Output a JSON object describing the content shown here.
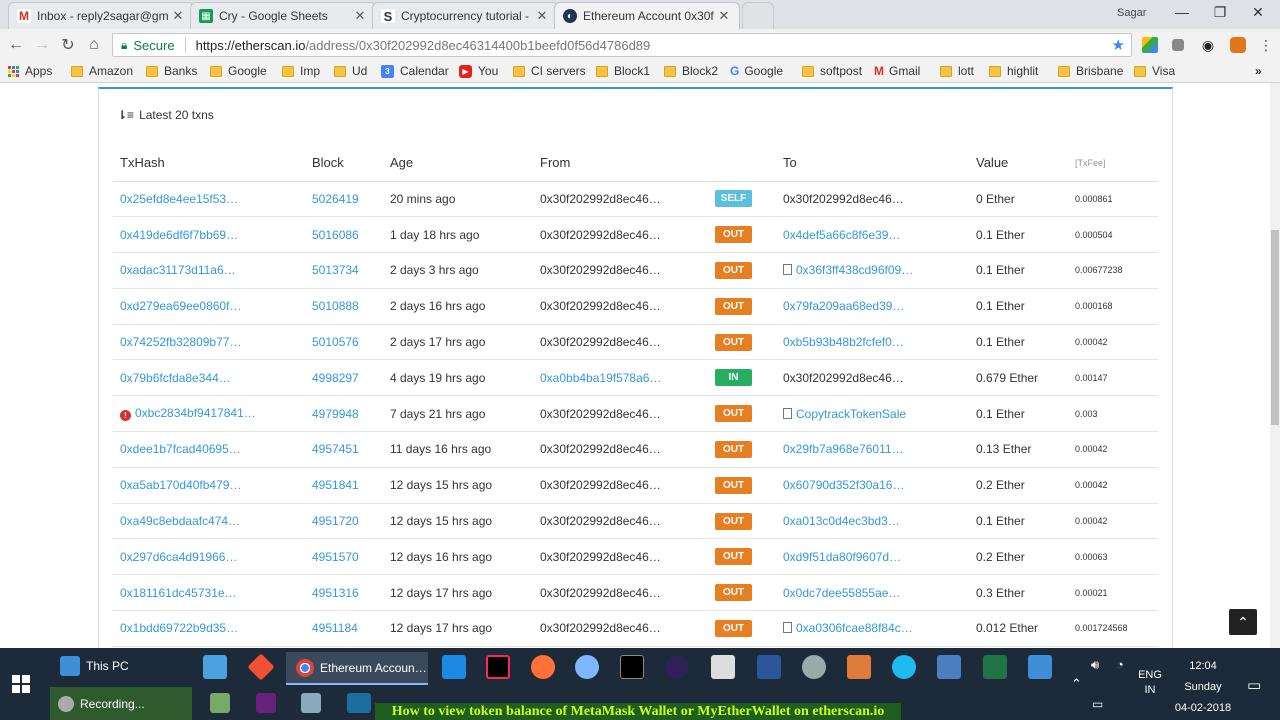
{
  "browser": {
    "user": "Sagar",
    "tabs": [
      {
        "title": "Inbox - reply2sagar@gm",
        "icon": "gmail-icon",
        "color": "#d93025"
      },
      {
        "title": "Cry - Google Sheets",
        "icon": "sheets-icon",
        "color": "#0f9d58"
      },
      {
        "title": "Cryptocurrency tutorial -",
        "icon": "s-icon",
        "color": "#333333"
      },
      {
        "title": "Ethereum Account 0x30f",
        "icon": "etherscan-icon",
        "color": "#21325b"
      }
    ],
    "secure_label": "Secure",
    "url_host": "https://etherscan.io",
    "url_path": "/address/0x30f202992d8ec46314400b1beefd0f56d4786d89",
    "bookmarks": [
      {
        "label": "Apps",
        "icon": "apps-icon"
      },
      {
        "label": "Amazon",
        "icon": "folder-icon"
      },
      {
        "label": "Banks",
        "icon": "folder-icon"
      },
      {
        "label": "Google",
        "icon": "folder-icon"
      },
      {
        "label": "Imp",
        "icon": "folder-icon"
      },
      {
        "label": "Ud",
        "icon": "folder-icon"
      },
      {
        "label": "Calendar",
        "icon": "calendar-icon"
      },
      {
        "label": "You",
        "icon": "youtube-icon"
      },
      {
        "label": "CI servers",
        "icon": "folder-icon"
      },
      {
        "label": "Block1",
        "icon": "folder-icon"
      },
      {
        "label": "Block2",
        "icon": "folder-icon"
      },
      {
        "label": "Google",
        "icon": "google-icon"
      },
      {
        "label": "softpost",
        "icon": "folder-icon"
      },
      {
        "label": "Gmail",
        "icon": "gmail-icon"
      },
      {
        "label": "lott",
        "icon": "folder-icon"
      },
      {
        "label": "highlit",
        "icon": "folder-icon"
      },
      {
        "label": "Brisbane",
        "icon": "folder-icon"
      },
      {
        "label": "Visa",
        "icon": "folder-icon"
      }
    ]
  },
  "txlist": {
    "latest_label": "Latest 20 txns",
    "headers": {
      "hash": "TxHash",
      "block": "Block",
      "age": "Age",
      "from": "From",
      "to": "To",
      "value": "Value",
      "fee": "[TxFee]"
    },
    "rows": [
      {
        "hash": "0x25efd8e4ee15f53…",
        "block": "5026419",
        "age": "20 mins ago",
        "from": "0x30f202992d8ec46…",
        "from_link": false,
        "dir": "SELF",
        "to": "0x30f202992d8ec46…",
        "to_link": false,
        "to_contract": false,
        "value": "0 Ether",
        "fee": "0.000861",
        "error": false
      },
      {
        "hash": "0x419de6df6f7bb69…",
        "block": "5016086",
        "age": "1 day 18 hrs ago",
        "from": "0x30f202992d8ec46…",
        "from_link": false,
        "dir": "OUT",
        "to": "0x4def5a66c8f6e39…",
        "to_link": true,
        "to_contract": false,
        "value": "0.1 Ether",
        "fee": "0.000504",
        "error": false
      },
      {
        "hash": "0xadac31173d11a6…",
        "block": "5013734",
        "age": "2 days 3 hrs ago",
        "from": "0x30f202992d8ec46…",
        "from_link": false,
        "dir": "OUT",
        "to": "0x36f3ff438cd96f09…",
        "to_link": true,
        "to_contract": true,
        "value": "0.1 Ether",
        "fee": "0.00677238",
        "error": false
      },
      {
        "hash": "0xd279ea69ee0860f…",
        "block": "5010888",
        "age": "2 days 16 hrs ago",
        "from": "0x30f202992d8ec46…",
        "from_link": false,
        "dir": "OUT",
        "to": "0x79fa209aa68ed39…",
        "to_link": true,
        "to_contract": false,
        "value": "0.1 Ether",
        "fee": "0.000168",
        "error": false
      },
      {
        "hash": "0x74252fb32809b77…",
        "block": "5010576",
        "age": "2 days 17 hrs ago",
        "from": "0x30f202992d8ec46…",
        "from_link": false,
        "dir": "OUT",
        "to": "0xb5b93b48b2fcfef0…",
        "to_link": true,
        "to_contract": false,
        "value": "0.1 Ether",
        "fee": "0.00042",
        "error": false
      },
      {
        "hash": "0x79b6fcfda8e344…",
        "block": "4998297",
        "age": "4 days 19 hrs ago",
        "from": "0xa0bb4ba19f578a6…",
        "from_link": true,
        "dir": "IN",
        "to": "0x30f202992d8ec46…",
        "to_link": false,
        "to_contract": false,
        "value": "0.679 Ether",
        "fee": "0.00147",
        "error": false
      },
      {
        "hash": "0xbc2834bf9417841…",
        "block": "4979948",
        "age": "7 days 21 hrs ago",
        "from": "0x30f202992d8ec46…",
        "from_link": false,
        "dir": "OUT",
        "to": "CopytrackTokenSale",
        "to_link": true,
        "to_contract": true,
        "value": "0.1 Ether",
        "fee": "0.003",
        "error": true
      },
      {
        "hash": "0xdee1b7fcad40695…",
        "block": "4957451",
        "age": "11 days 16 hrs ago",
        "from": "0x30f202992d8ec46…",
        "from_link": false,
        "dir": "OUT",
        "to": "0x29fb7a968e76011…",
        "to_link": true,
        "to_contract": false,
        "value": "0.13 Ether",
        "fee": "0.00042",
        "error": false
      },
      {
        "hash": "0xa5ab170d40fb479…",
        "block": "4951841",
        "age": "12 days 15 hrs ago",
        "from": "0x30f202992d8ec46…",
        "from_link": false,
        "dir": "OUT",
        "to": "0x60790d352f30a16…",
        "to_link": true,
        "to_contract": false,
        "value": "0.2 Ether",
        "fee": "0.00042",
        "error": false
      },
      {
        "hash": "0xa49c8ebdaafc474…",
        "block": "4951720",
        "age": "12 days 15 hrs ago",
        "from": "0x30f202992d8ec46…",
        "from_link": false,
        "dir": "OUT",
        "to": "0xa013c0d4ec3bd3…",
        "to_link": true,
        "to_contract": false,
        "value": "0.1 Ether",
        "fee": "0.00042",
        "error": false
      },
      {
        "hash": "0x297d6ca4d91966…",
        "block": "4951570",
        "age": "12 days 16 hrs ago",
        "from": "0x30f202992d8ec46…",
        "from_link": false,
        "dir": "OUT",
        "to": "0xd9f51da80f9607d…",
        "to_link": true,
        "to_contract": false,
        "value": "0.2 Ether",
        "fee": "0.00063",
        "error": false
      },
      {
        "hash": "0x181161dc45731e…",
        "block": "4951316",
        "age": "12 days 17 hrs ago",
        "from": "0x30f202992d8ec46…",
        "from_link": false,
        "dir": "OUT",
        "to": "0x0dc7dee55855ae…",
        "to_link": true,
        "to_contract": false,
        "value": "0.3 Ether",
        "fee": "0.00021",
        "error": false
      },
      {
        "hash": "0x1bdd69722b9d35…",
        "block": "4951184",
        "age": "12 days 17 hrs ago",
        "from": "0x30f202992d8ec46…",
        "from_link": false,
        "dir": "OUT",
        "to": "0xa0306fcae88f84c…",
        "to_link": true,
        "to_contract": true,
        "value": "0.012 Ether",
        "fee": "0.001724568",
        "error": false
      }
    ]
  },
  "taskbar": {
    "this_pc": "This PC",
    "chrome_label": "Ethereum Accoun…",
    "recording": "Recording...",
    "caption": "How to view token balance of MetaMask Wallet or MyEtherWallet on etherscan.io",
    "lang_line1": "ENG",
    "lang_line2": "IN",
    "time": "12:04",
    "day": "Sunday",
    "date": "04-02-2018"
  }
}
